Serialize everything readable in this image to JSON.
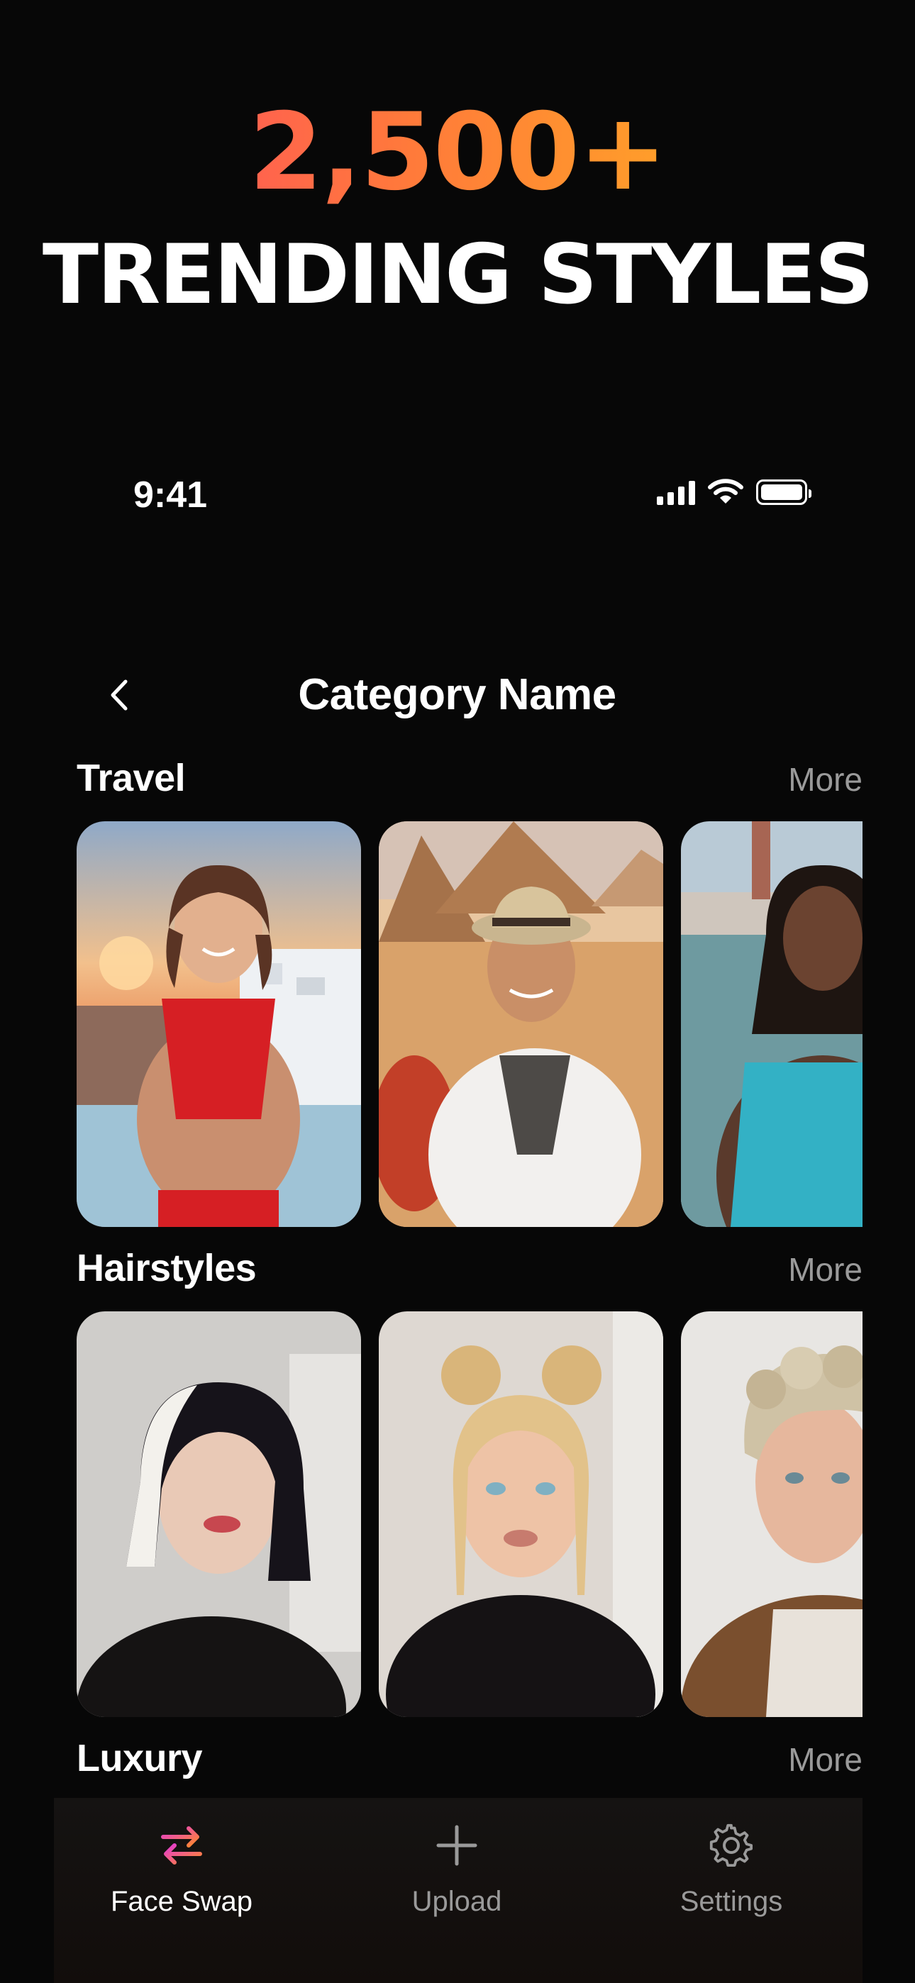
{
  "promo": {
    "count": "2,500+",
    "headline": "TRENDING STYLES"
  },
  "status_bar": {
    "time": "9:41",
    "icons": [
      "signal-icon",
      "wifi-icon",
      "battery-icon"
    ]
  },
  "header": {
    "back_icon": "chevron-left-icon",
    "title": "Category Name"
  },
  "sections": [
    {
      "title": "Travel",
      "more": "More",
      "cards": [
        "santorini-woman-red-top",
        "pyramids-man-straw-hat",
        "venice-woman-teal-dress"
      ]
    },
    {
      "title": "Hairstyles",
      "more": "More",
      "cards": [
        "two-tone-bob-woman",
        "blonde-space-buns-woman",
        "curly-blond-man"
      ]
    },
    {
      "title": "Luxury",
      "more": "More",
      "cards": []
    }
  ],
  "tab_bar": {
    "tabs": [
      {
        "label": "Face Swap",
        "icon": "swap-arrows-icon",
        "active": true
      },
      {
        "label": "Upload",
        "icon": "plus-icon",
        "active": false
      },
      {
        "label": "Settings",
        "icon": "gear-icon",
        "active": false
      }
    ]
  },
  "colors": {
    "background": "#070707",
    "accent_start": "#ff3f6c",
    "accent_end": "#ffc21a",
    "muted_text": "#9a9a9a"
  }
}
